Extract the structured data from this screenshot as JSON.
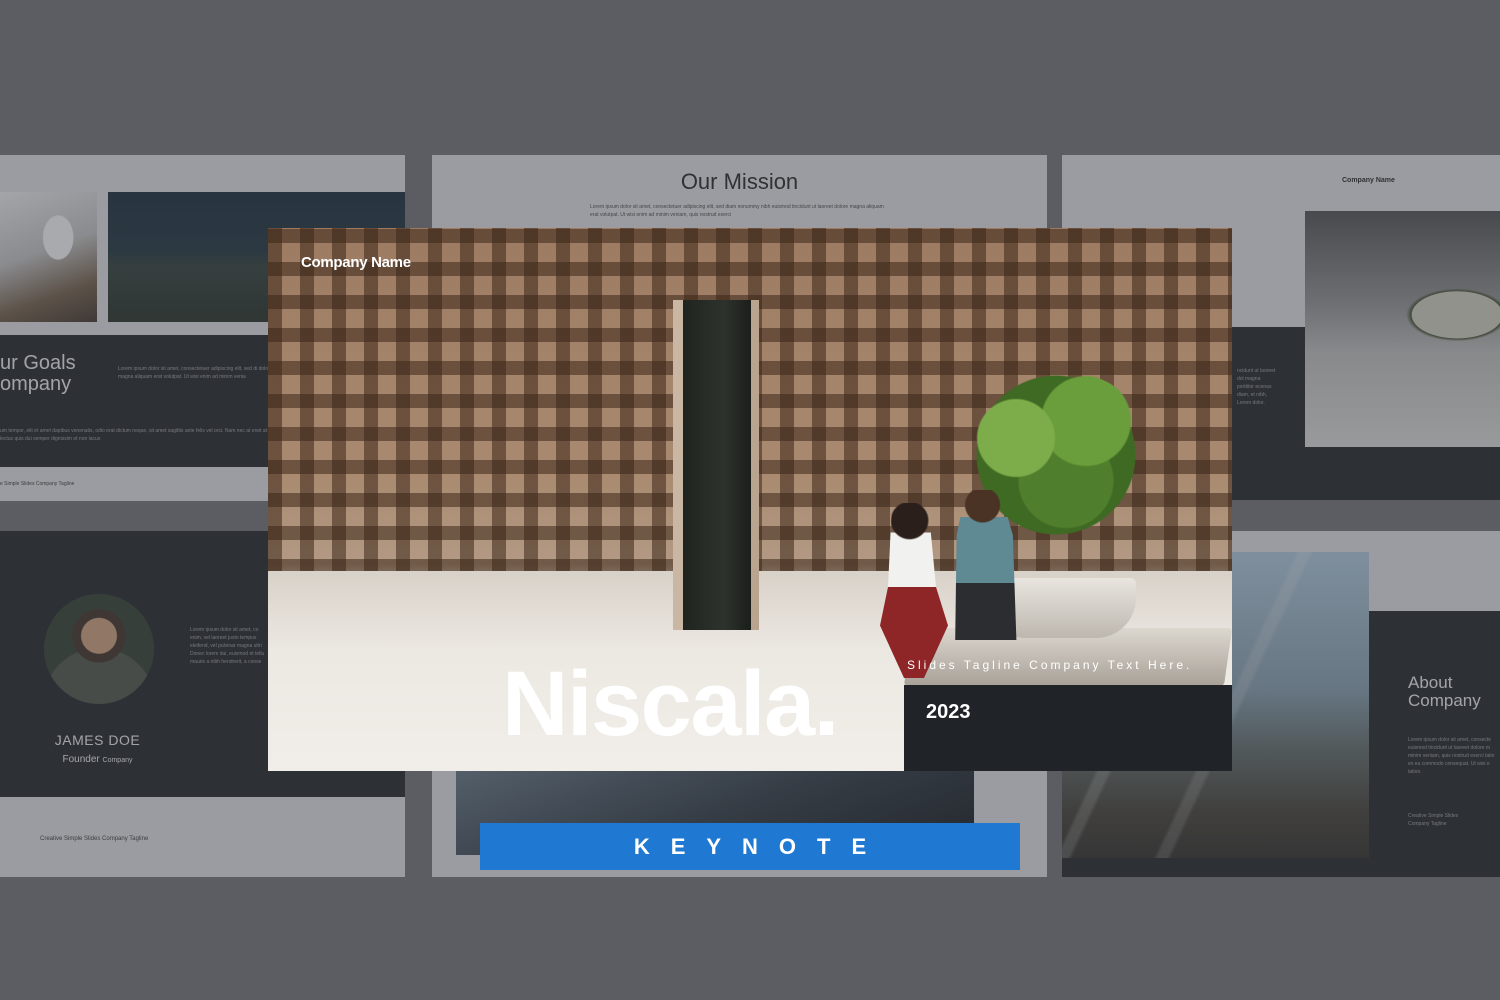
{
  "hero": {
    "company": "Company Name",
    "title": "Niscala.",
    "tagline": "Slides Tagline Company Text Here.",
    "year": "2023"
  },
  "badge": {
    "label": "KEYNOTE"
  },
  "mission_slide": {
    "title": "Our Mission",
    "body": "Lorem ipsum dolor sit amet, consectetuer adipiscing elit, sed diam nonummy nibh euismod tincidunt ut laoreet dolore magna aliquam erat volutpat. Ut wisi enim ad minim veniam, quis nostrud exerci"
  },
  "goals_slide": {
    "title_line1": "ur Goals",
    "title_line2": "ompany",
    "body_right": "Lorem ipsum dolor sit amet, consectetuer adipiscing elit, sed di dolore magna aliquam erat volutpat. Ut wisi enim ad minim venia",
    "body_bottom": "um tempor, elit et amet dapibus venenatis, odio erat dictum neque, sit amet sagittis ante felis vel orci. Nam nec at enet at lectus quis dui semper dignissim et non lacus",
    "footer": "e Simple Slides Company Tagline"
  },
  "team_slide": {
    "name": "JAMES DOE",
    "role": "Founder",
    "role_suffix": "Company",
    "body": "Lorem ipsum dolor sit amet, co enim, vel laoreet justo tempus eleifend, vel pulvinar magna ultri Donec lorem dui, euismod et tellu mauris a nibh hendrerit, a conse",
    "footer": "Creative Simple Slides Company Tagline"
  },
  "right_top_slide": {
    "company": "Company Name",
    "body": "ncidunt ut laoreet dol magna porttitor ecenas diam, et nibh, Lorem dolor."
  },
  "about_slide": {
    "title_line1": "About",
    "title_line2": "Company",
    "body": "Lorem ipsum dolor sit amet, consecte euismod tincidunt ut laoreet dolore m minim veniam, quis nostrud exerci tatio ex ea commodo consequat. Ut wisi e tation.",
    "footer_line1": "Creative Simple Slides",
    "footer_line2": "Company Tagline"
  }
}
